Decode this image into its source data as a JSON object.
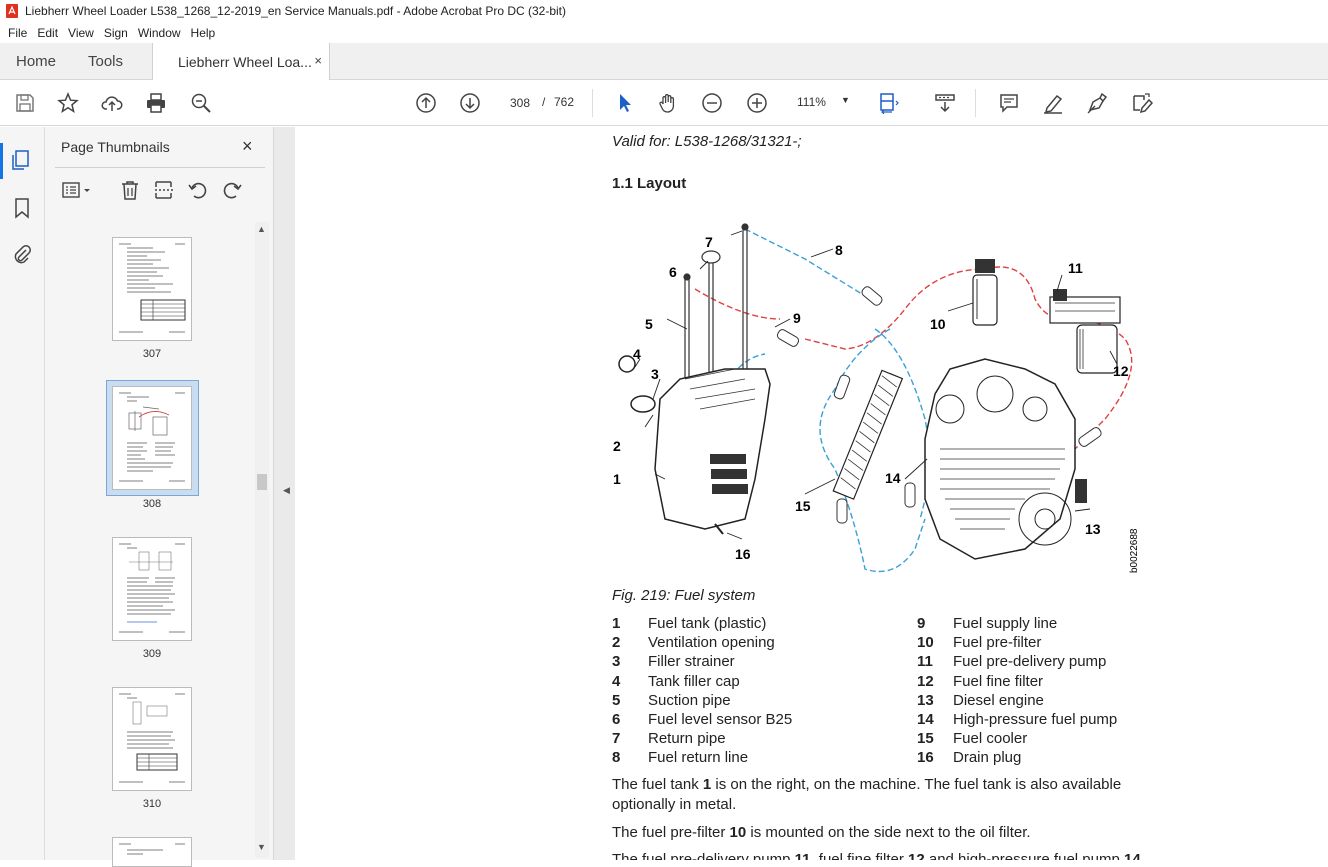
{
  "window": {
    "title": "Liebherr Wheel Loader L538_1268_12-2019_en Service Manuals.pdf - Adobe Acrobat Pro DC (32-bit)"
  },
  "menu": [
    "File",
    "Edit",
    "View",
    "Sign",
    "Window",
    "Help"
  ],
  "tabs": {
    "home": "Home",
    "tools": "Tools",
    "doc": "Liebherr Wheel Loa...",
    "doc_close": "×"
  },
  "toolbar": {
    "page_current": "308",
    "page_sep": "/",
    "page_total": "762",
    "zoom": "111%",
    "zoom_arrow": "▼"
  },
  "panel": {
    "title": "Page Thumbnails",
    "close": "×",
    "thumbnails": [
      {
        "label": "307"
      },
      {
        "label": "308",
        "selected": true
      },
      {
        "label": "309"
      },
      {
        "label": "310"
      }
    ]
  },
  "document": {
    "valid_for": "Valid for: L538-1268/31321-;",
    "heading": "1.1 Layout",
    "figure_labels": [
      "1",
      "2",
      "3",
      "4",
      "5",
      "6",
      "7",
      "8",
      "9",
      "10",
      "11",
      "12",
      "13",
      "14",
      "15",
      "16"
    ],
    "figure_code": "b0022688",
    "caption": "Fig. 219: Fuel system",
    "legend_left": [
      {
        "n": "1",
        "t": "Fuel tank (plastic)"
      },
      {
        "n": "2",
        "t": "Ventilation opening"
      },
      {
        "n": "3",
        "t": "Filler strainer"
      },
      {
        "n": "4",
        "t": "Tank filler cap"
      },
      {
        "n": "5",
        "t": "Suction pipe"
      },
      {
        "n": "6",
        "t": "Fuel level sensor B25"
      },
      {
        "n": "7",
        "t": "Return pipe"
      },
      {
        "n": "8",
        "t": "Fuel return line"
      }
    ],
    "legend_right": [
      {
        "n": "9",
        "t": "Fuel supply line"
      },
      {
        "n": "10",
        "t": "Fuel pre-filter"
      },
      {
        "n": "11",
        "t": "Fuel pre-delivery pump"
      },
      {
        "n": "12",
        "t": "Fuel fine filter"
      },
      {
        "n": "13",
        "t": "Diesel engine"
      },
      {
        "n": "14",
        "t": "High-pressure fuel pump"
      },
      {
        "n": "15",
        "t": "Fuel cooler"
      },
      {
        "n": "16",
        "t": "Drain plug"
      }
    ],
    "para1_a": "The fuel tank ",
    "para1_b": "1",
    "para1_c": " is on the right, on the machine. The fuel tank is also available optionally in metal.",
    "para2_a": "The fuel pre-filter ",
    "para2_b": "10",
    "para2_c": " is mounted on the side next to the oil filter.",
    "para3_a": "The fuel pre-delivery pump ",
    "para3_b": "11",
    "para3_c": ", fuel fine filter ",
    "para3_d": "12",
    "para3_e": " and high-pressure fuel pump ",
    "para3_f": "14"
  },
  "colors": {
    "accent": "#1473e6",
    "supply_line": "#e04040",
    "return_line": "#3aa0d8"
  }
}
